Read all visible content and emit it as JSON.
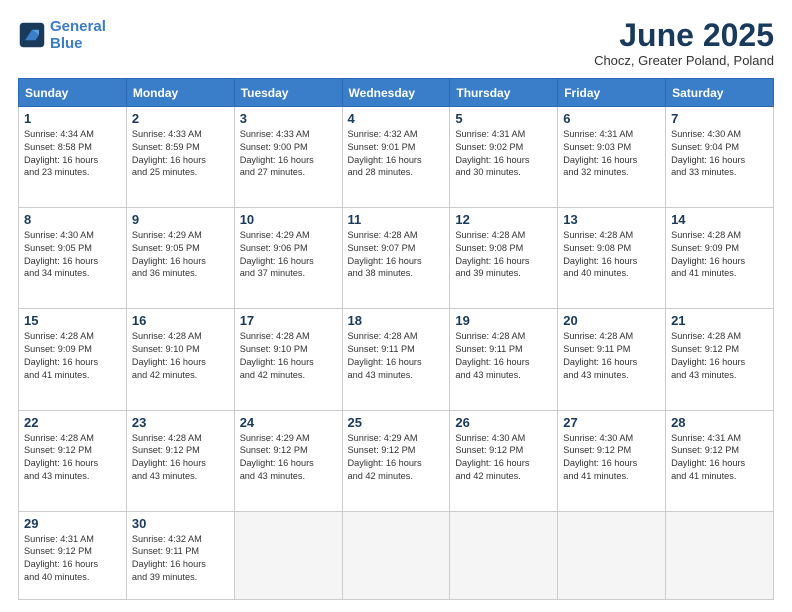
{
  "logo": {
    "line1": "General",
    "line2": "Blue"
  },
  "title": "June 2025",
  "subtitle": "Chocz, Greater Poland, Poland",
  "header_days": [
    "Sunday",
    "Monday",
    "Tuesday",
    "Wednesday",
    "Thursday",
    "Friday",
    "Saturday"
  ],
  "weeks": [
    [
      {
        "day": "1",
        "lines": [
          "Sunrise: 4:34 AM",
          "Sunset: 8:58 PM",
          "Daylight: 16 hours",
          "and 23 minutes."
        ]
      },
      {
        "day": "2",
        "lines": [
          "Sunrise: 4:33 AM",
          "Sunset: 8:59 PM",
          "Daylight: 16 hours",
          "and 25 minutes."
        ]
      },
      {
        "day": "3",
        "lines": [
          "Sunrise: 4:33 AM",
          "Sunset: 9:00 PM",
          "Daylight: 16 hours",
          "and 27 minutes."
        ]
      },
      {
        "day": "4",
        "lines": [
          "Sunrise: 4:32 AM",
          "Sunset: 9:01 PM",
          "Daylight: 16 hours",
          "and 28 minutes."
        ]
      },
      {
        "day": "5",
        "lines": [
          "Sunrise: 4:31 AM",
          "Sunset: 9:02 PM",
          "Daylight: 16 hours",
          "and 30 minutes."
        ]
      },
      {
        "day": "6",
        "lines": [
          "Sunrise: 4:31 AM",
          "Sunset: 9:03 PM",
          "Daylight: 16 hours",
          "and 32 minutes."
        ]
      },
      {
        "day": "7",
        "lines": [
          "Sunrise: 4:30 AM",
          "Sunset: 9:04 PM",
          "Daylight: 16 hours",
          "and 33 minutes."
        ]
      }
    ],
    [
      {
        "day": "8",
        "lines": [
          "Sunrise: 4:30 AM",
          "Sunset: 9:05 PM",
          "Daylight: 16 hours",
          "and 34 minutes."
        ]
      },
      {
        "day": "9",
        "lines": [
          "Sunrise: 4:29 AM",
          "Sunset: 9:05 PM",
          "Daylight: 16 hours",
          "and 36 minutes."
        ]
      },
      {
        "day": "10",
        "lines": [
          "Sunrise: 4:29 AM",
          "Sunset: 9:06 PM",
          "Daylight: 16 hours",
          "and 37 minutes."
        ]
      },
      {
        "day": "11",
        "lines": [
          "Sunrise: 4:28 AM",
          "Sunset: 9:07 PM",
          "Daylight: 16 hours",
          "and 38 minutes."
        ]
      },
      {
        "day": "12",
        "lines": [
          "Sunrise: 4:28 AM",
          "Sunset: 9:08 PM",
          "Daylight: 16 hours",
          "and 39 minutes."
        ]
      },
      {
        "day": "13",
        "lines": [
          "Sunrise: 4:28 AM",
          "Sunset: 9:08 PM",
          "Daylight: 16 hours",
          "and 40 minutes."
        ]
      },
      {
        "day": "14",
        "lines": [
          "Sunrise: 4:28 AM",
          "Sunset: 9:09 PM",
          "Daylight: 16 hours",
          "and 41 minutes."
        ]
      }
    ],
    [
      {
        "day": "15",
        "lines": [
          "Sunrise: 4:28 AM",
          "Sunset: 9:09 PM",
          "Daylight: 16 hours",
          "and 41 minutes."
        ]
      },
      {
        "day": "16",
        "lines": [
          "Sunrise: 4:28 AM",
          "Sunset: 9:10 PM",
          "Daylight: 16 hours",
          "and 42 minutes."
        ]
      },
      {
        "day": "17",
        "lines": [
          "Sunrise: 4:28 AM",
          "Sunset: 9:10 PM",
          "Daylight: 16 hours",
          "and 42 minutes."
        ]
      },
      {
        "day": "18",
        "lines": [
          "Sunrise: 4:28 AM",
          "Sunset: 9:11 PM",
          "Daylight: 16 hours",
          "and 43 minutes."
        ]
      },
      {
        "day": "19",
        "lines": [
          "Sunrise: 4:28 AM",
          "Sunset: 9:11 PM",
          "Daylight: 16 hours",
          "and 43 minutes."
        ]
      },
      {
        "day": "20",
        "lines": [
          "Sunrise: 4:28 AM",
          "Sunset: 9:11 PM",
          "Daylight: 16 hours",
          "and 43 minutes."
        ]
      },
      {
        "day": "21",
        "lines": [
          "Sunrise: 4:28 AM",
          "Sunset: 9:12 PM",
          "Daylight: 16 hours",
          "and 43 minutes."
        ]
      }
    ],
    [
      {
        "day": "22",
        "lines": [
          "Sunrise: 4:28 AM",
          "Sunset: 9:12 PM",
          "Daylight: 16 hours",
          "and 43 minutes."
        ]
      },
      {
        "day": "23",
        "lines": [
          "Sunrise: 4:28 AM",
          "Sunset: 9:12 PM",
          "Daylight: 16 hours",
          "and 43 minutes."
        ]
      },
      {
        "day": "24",
        "lines": [
          "Sunrise: 4:29 AM",
          "Sunset: 9:12 PM",
          "Daylight: 16 hours",
          "and 43 minutes."
        ]
      },
      {
        "day": "25",
        "lines": [
          "Sunrise: 4:29 AM",
          "Sunset: 9:12 PM",
          "Daylight: 16 hours",
          "and 42 minutes."
        ]
      },
      {
        "day": "26",
        "lines": [
          "Sunrise: 4:30 AM",
          "Sunset: 9:12 PM",
          "Daylight: 16 hours",
          "and 42 minutes."
        ]
      },
      {
        "day": "27",
        "lines": [
          "Sunrise: 4:30 AM",
          "Sunset: 9:12 PM",
          "Daylight: 16 hours",
          "and 41 minutes."
        ]
      },
      {
        "day": "28",
        "lines": [
          "Sunrise: 4:31 AM",
          "Sunset: 9:12 PM",
          "Daylight: 16 hours",
          "and 41 minutes."
        ]
      }
    ],
    [
      {
        "day": "29",
        "lines": [
          "Sunrise: 4:31 AM",
          "Sunset: 9:12 PM",
          "Daylight: 16 hours",
          "and 40 minutes."
        ]
      },
      {
        "day": "30",
        "lines": [
          "Sunrise: 4:32 AM",
          "Sunset: 9:11 PM",
          "Daylight: 16 hours",
          "and 39 minutes."
        ]
      },
      {
        "day": "",
        "lines": []
      },
      {
        "day": "",
        "lines": []
      },
      {
        "day": "",
        "lines": []
      },
      {
        "day": "",
        "lines": []
      },
      {
        "day": "",
        "lines": []
      }
    ]
  ]
}
